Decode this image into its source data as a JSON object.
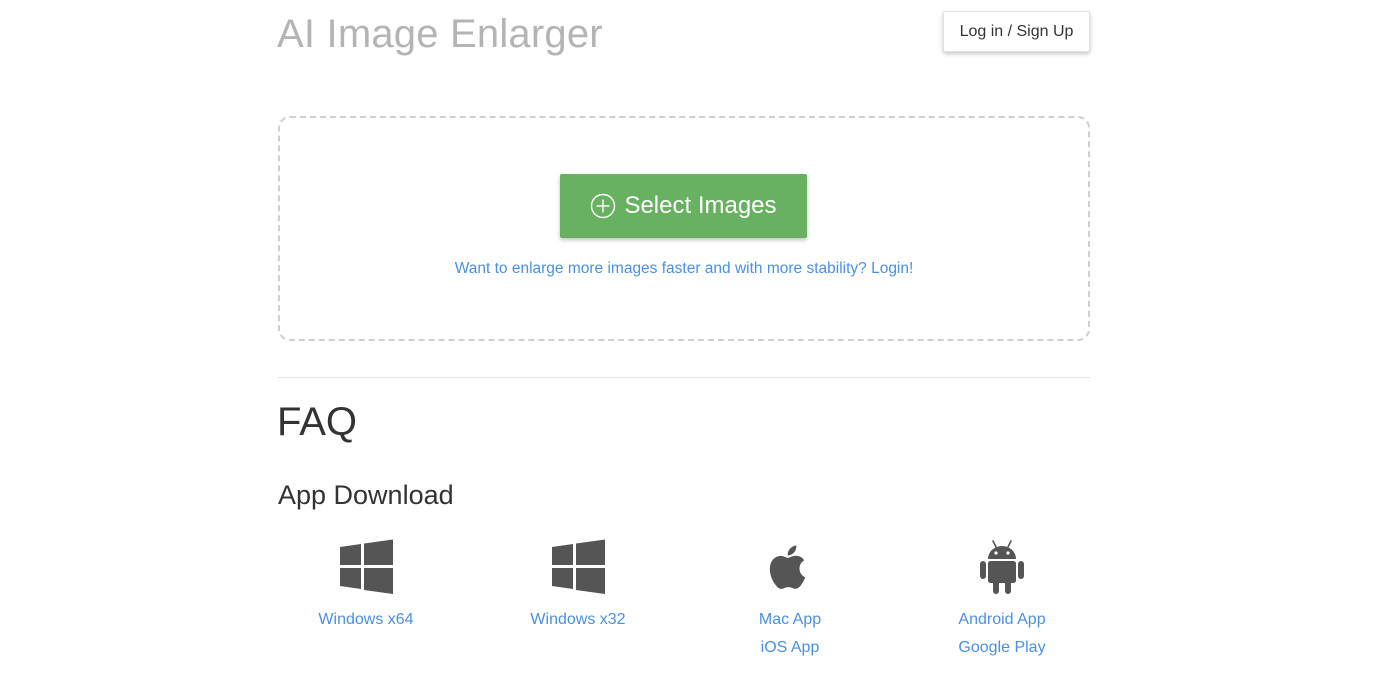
{
  "header": {
    "title": "AI Image Enlarger",
    "login_label": "Log in / Sign Up"
  },
  "upload": {
    "select_label": "Select Images",
    "login_hint": "Want to enlarge more images faster and with more stability? Login!"
  },
  "faq": {
    "title": "FAQ"
  },
  "downloads": {
    "title": "App Download",
    "apps": [
      {
        "icon": "windows-icon",
        "links": [
          "Windows x64"
        ]
      },
      {
        "icon": "windows-icon",
        "links": [
          "Windows x32"
        ]
      },
      {
        "icon": "apple-icon",
        "links": [
          "Mac App",
          "iOS App"
        ]
      },
      {
        "icon": "android-icon",
        "links": [
          "Android App",
          "Google Play"
        ]
      }
    ]
  },
  "colors": {
    "primary_green": "#68b160",
    "link_blue": "#4a90e2",
    "title_gray": "#b4b4b4",
    "icon_gray": "#555555"
  }
}
